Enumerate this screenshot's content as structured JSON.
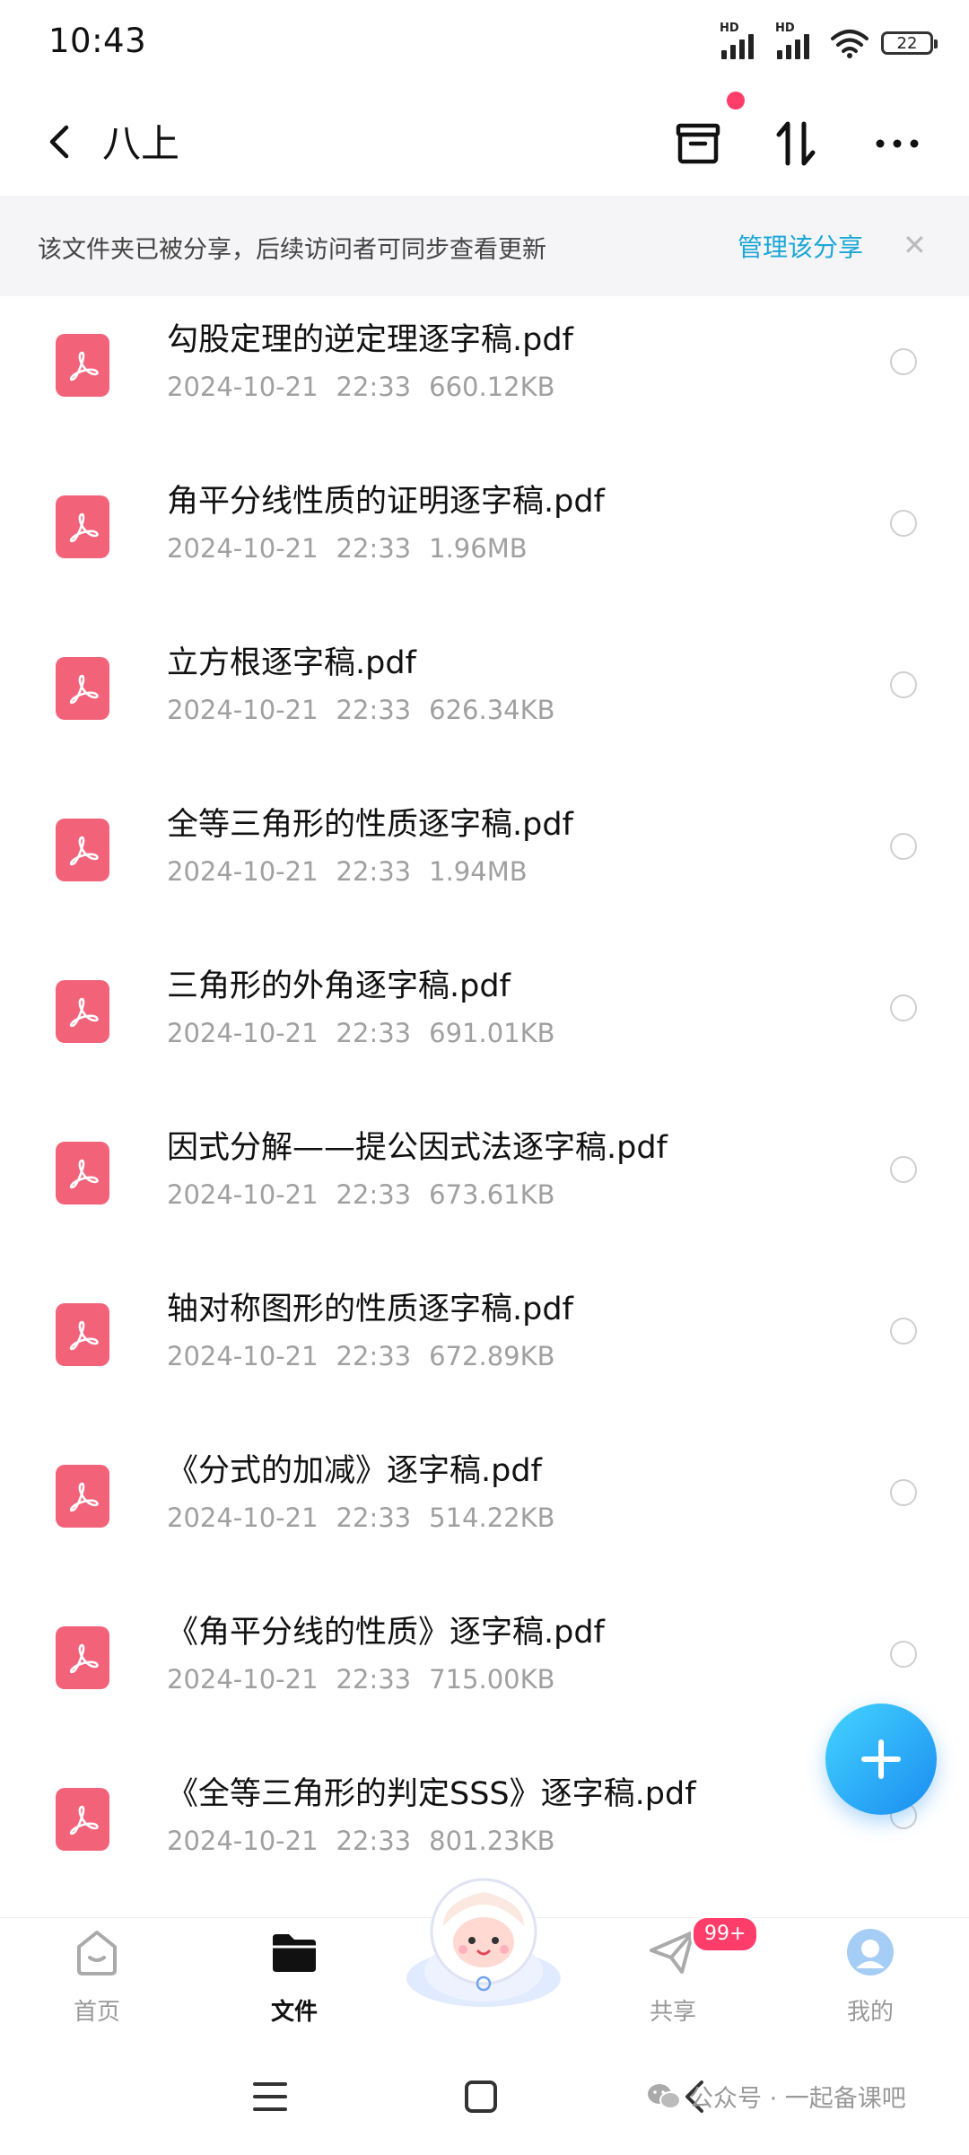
{
  "status_bar": {
    "time": "10:43",
    "signal1_label": "HD",
    "signal2_label": "HD",
    "battery": "22"
  },
  "header": {
    "title": "八上"
  },
  "banner": {
    "text": "该文件夹已被分享，后续访问者可同步查看更新",
    "manage_label": "管理该分享",
    "close": "✕"
  },
  "files": [
    {
      "name": "勾股定理的逆定理逐字稿.pdf",
      "date": "2024-10-21",
      "time": "22:33",
      "size": "660.12KB"
    },
    {
      "name": "角平分线性质的证明逐字稿.pdf",
      "date": "2024-10-21",
      "time": "22:33",
      "size": "1.96MB"
    },
    {
      "name": "立方根逐字稿.pdf",
      "date": "2024-10-21",
      "time": "22:33",
      "size": "626.34KB"
    },
    {
      "name": "全等三角形的性质逐字稿.pdf",
      "date": "2024-10-21",
      "time": "22:33",
      "size": "1.94MB"
    },
    {
      "name": "三角形的外角逐字稿.pdf",
      "date": "2024-10-21",
      "time": "22:33",
      "size": "691.01KB"
    },
    {
      "name": "因式分解——提公因式法逐字稿.pdf",
      "date": "2024-10-21",
      "time": "22:33",
      "size": "673.61KB"
    },
    {
      "name": "轴对称图形的性质逐字稿.pdf",
      "date": "2024-10-21",
      "time": "22:33",
      "size": "672.89KB"
    },
    {
      "name": "《分式的加减》逐字稿.pdf",
      "date": "2024-10-21",
      "time": "22:33",
      "size": "514.22KB"
    },
    {
      "name": "《角平分线的性质》逐字稿.pdf",
      "date": "2024-10-21",
      "time": "22:33",
      "size": "715.00KB"
    },
    {
      "name": "《全等三角形的判定SSS》逐字稿.pdf",
      "date": "2024-10-21",
      "time": "22:33",
      "size": "801.23KB"
    }
  ],
  "bottom_nav": {
    "items": [
      {
        "label": "首页",
        "icon": "home-icon"
      },
      {
        "label": "文件",
        "icon": "folder-icon",
        "active": true
      },
      {
        "label": "共享",
        "icon": "send-icon"
      },
      {
        "label": "我的",
        "icon": "profile-icon"
      }
    ],
    "share_badge": "99+"
  },
  "watermark": "公众号 · 一起备课吧",
  "colors": {
    "accent": "#1ca7d6",
    "pdf": "#f2637a",
    "badge": "#ff3d6a",
    "fab": "#1a8cf0"
  }
}
